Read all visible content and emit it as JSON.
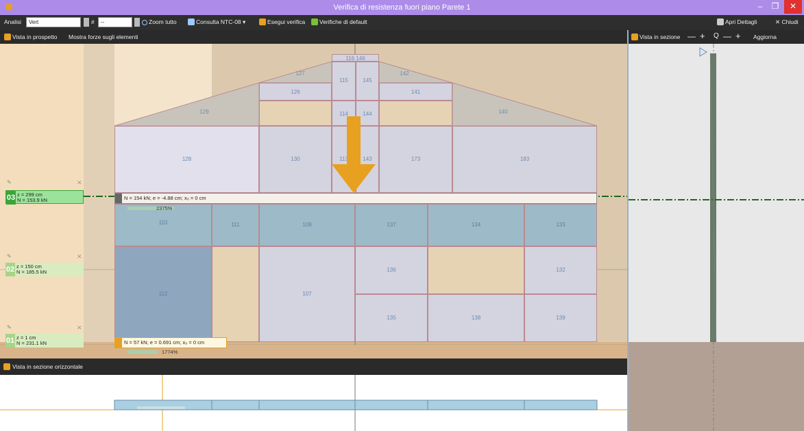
{
  "window": {
    "title": "Verifica di resistenza fuori piano Parete 1",
    "minimize": "–",
    "maximize": "❐",
    "close": "✕"
  },
  "toolbar": {
    "analysis_label": "Analisi",
    "analysis_value": "Vert",
    "hash_label": "#",
    "hash_value": "--",
    "zoom_all": "Zoom tutto",
    "consult": "Consulta NTC-08 ▾",
    "run_check": "Esegui verifica",
    "default_checks": "Verifiche di default",
    "open_details": "Apri Dettagli",
    "close_label": "Chiudi"
  },
  "left_toolbar": {
    "elevation_view": "Vista in prospetto",
    "show_forces": "Mostra forze sugli elementi"
  },
  "right_toolbar": {
    "section_view": "Vista in sezione",
    "minus": "—",
    "plus": "+",
    "zoom_icon": "Q",
    "update": "Aggiorna"
  },
  "levels": [
    {
      "num": "03",
      "z": "z = 299 cm",
      "n": "N = 153.9 kN",
      "color": "#3aa63a",
      "bg": "#9be39a"
    },
    {
      "num": "02",
      "z": "z = 150 cm",
      "n": "N = 185.5 kN",
      "color": "#a8d48a",
      "bg": "#d8ecc0"
    },
    {
      "num": "01",
      "z": "z = 1 cm",
      "n": "N = 231.1 kN",
      "color": "#a8d48a",
      "bg": "#d8ecc0"
    }
  ],
  "walls": {
    "w116": "116",
    "w146": "146",
    "w127": "127",
    "w142": "142",
    "w115": "115",
    "w145": "145",
    "w126": "126",
    "w141": "141",
    "w129": "129",
    "w114": "114",
    "w144": "144",
    "w140": "140",
    "w128": "128",
    "w130": "130",
    "w113": "113",
    "w143": "143",
    "w173": "173",
    "w183": "183",
    "w110": "110",
    "w111": "111",
    "w108": "108",
    "w137": "137",
    "w134": "134",
    "w133": "133",
    "w112": "112",
    "w107": "107",
    "w136": "136",
    "w132": "132",
    "w135": "135",
    "w138": "138",
    "w139": "139"
  },
  "results": {
    "r03": "N = 154 kN; e = -4.88 cm; x₀ = 0 cm",
    "r03_pct": "2375%",
    "r01": "N = 57 kN; e = 0.691 cm; x₀ = 0 cm",
    "r01_pct": "1774%"
  },
  "horizontal_section": {
    "label": "Vista in sezione orizzontale"
  },
  "colors": {
    "accent_orange": "#e8a020",
    "level_green": "#1a6a1a",
    "titlebar": "#ac8ce8"
  }
}
